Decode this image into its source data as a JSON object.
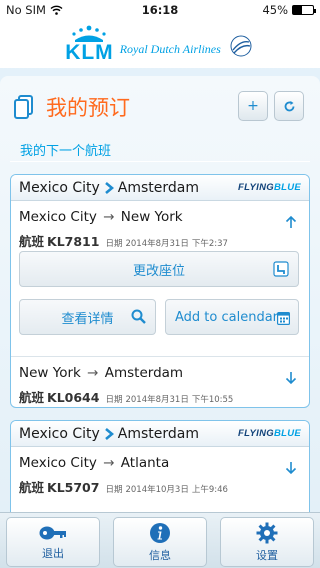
{
  "status_bar": {
    "carrier": "No SIM",
    "time": "16:18",
    "battery": "45%",
    "battery_fraction": 0.45
  },
  "brand": {
    "logo_text": "KLM",
    "tagline": "Royal Dutch Airlines",
    "seal_text": "SKYTEAM"
  },
  "page": {
    "title": "我的预订",
    "subtitle": "我的下一个航班"
  },
  "toolbar": {
    "add_label": "+",
    "refresh_icon": "refresh-icon"
  },
  "trips": [
    {
      "origin": "Mexico City",
      "destination": "Amsterdam",
      "program": "FLYINGBLUE",
      "segments": [
        {
          "origin": "Mexico City",
          "destination": "New York",
          "flight_label": "航班",
          "flight_number": "KL7811",
          "date_label": "日期",
          "date": "2014年8月31日",
          "time": "下午2:37",
          "expanded": true
        },
        {
          "origin": "New York",
          "destination": "Amsterdam",
          "flight_label": "航班",
          "flight_number": "KL0644",
          "date_label": "日期",
          "date": "2014年8月31日",
          "time": "下午10:55",
          "expanded": false
        }
      ],
      "actions": {
        "change_seat": "更改座位",
        "view_details": "查看详情",
        "add_calendar": "Add to calendar"
      }
    },
    {
      "origin": "Mexico City",
      "destination": "Amsterdam",
      "program": "FLYINGBLUE",
      "segments": [
        {
          "origin": "Mexico City",
          "destination": "Atlanta",
          "flight_label": "航班",
          "flight_number": "KL5707",
          "date_label": "日期",
          "date": "2014年10月3日",
          "time": "上午9:46",
          "expanded": false
        }
      ]
    }
  ],
  "tab_bar": [
    {
      "label": "退出",
      "icon": "key-icon"
    },
    {
      "label": "信息",
      "icon": "info-icon"
    },
    {
      "label": "设置",
      "icon": "gear-icon"
    }
  ],
  "colors": {
    "accent_blue": "#00a1e4",
    "title_orange": "#ff6a1e",
    "link_blue": "#1f8ccf"
  }
}
